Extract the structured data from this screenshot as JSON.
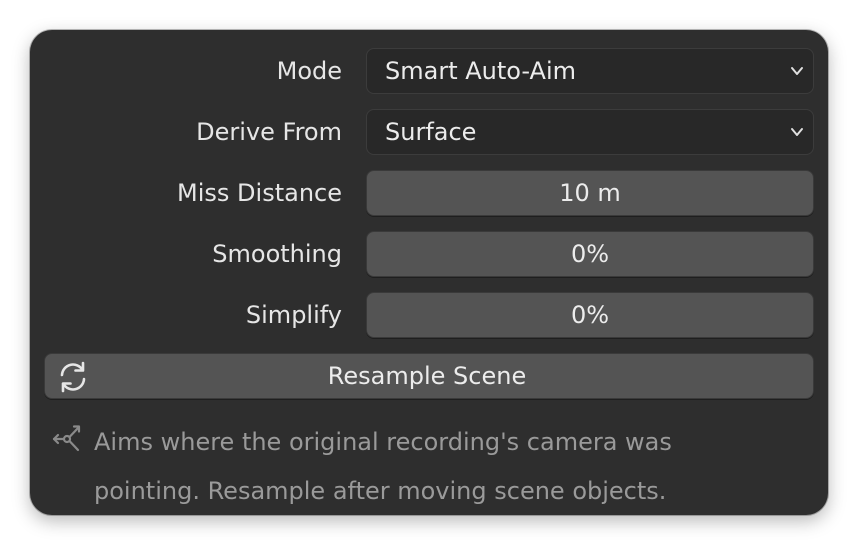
{
  "panel": {
    "rows": [
      {
        "label": "Mode",
        "kind": "dropdown",
        "value": "Smart Auto-Aim"
      },
      {
        "label": "Derive From",
        "kind": "dropdown",
        "value": "Surface"
      },
      {
        "label": "Miss Distance",
        "kind": "number",
        "value": "10 m"
      },
      {
        "label": "Smoothing",
        "kind": "number",
        "value": "0%"
      },
      {
        "label": "Simplify",
        "kind": "number",
        "value": "0%"
      }
    ],
    "resample_button": {
      "label": "Resample Scene",
      "icon": "refresh-icon"
    },
    "info": {
      "icon": "node-link-icon",
      "text": "Aims where the original recording's camera was pointing. Resample after moving scene objects."
    }
  },
  "colors": {
    "panel_bg": "#2e2e2e",
    "dropdown_bg": "#282828",
    "field_bg": "#545454",
    "text": "#e6e6e6",
    "muted_text": "#9a9a9a"
  }
}
